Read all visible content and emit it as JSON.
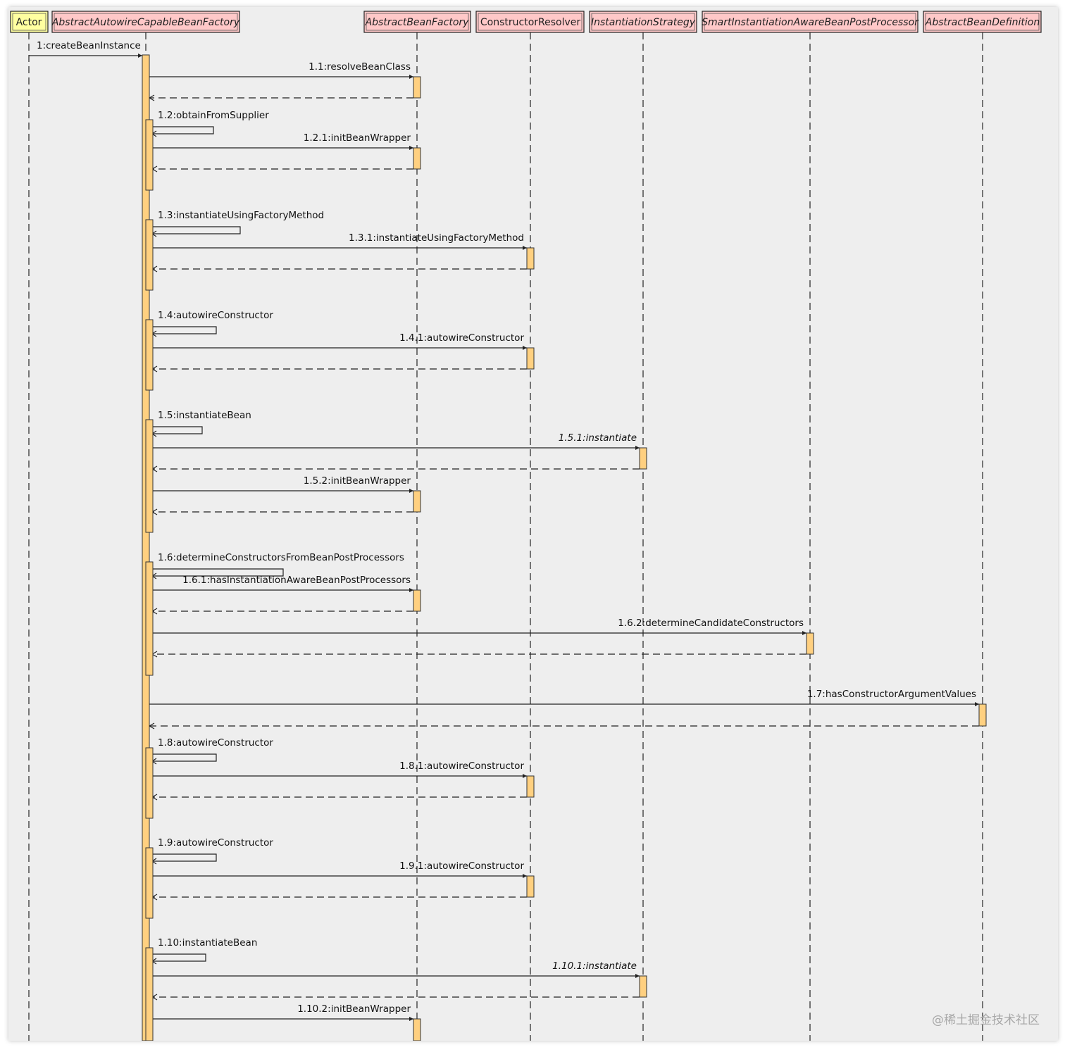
{
  "participants": [
    {
      "id": "actor",
      "label": "Actor",
      "italic": false,
      "fill": "#ffffa0"
    },
    {
      "id": "aacbf",
      "label": "AbstractAutowireCapableBeanFactory",
      "italic": true,
      "fill": "#ffc8c8"
    },
    {
      "id": "abf",
      "label": "AbstractBeanFactory",
      "italic": true,
      "fill": "#ffc8c8"
    },
    {
      "id": "cr",
      "label": "ConstructorResolver",
      "italic": false,
      "fill": "#ffc8c8"
    },
    {
      "id": "is",
      "label": "InstantiationStrategy",
      "italic": true,
      "fill": "#ffc8c8"
    },
    {
      "id": "siabpp",
      "label": "SmartInstantiationAwareBeanPostProcessor",
      "italic": true,
      "fill": "#ffc8c8"
    },
    {
      "id": "abd",
      "label": "AbstractBeanDefinition",
      "italic": true,
      "fill": "#ffc8c8"
    }
  ],
  "messages": [
    {
      "label": "1:createBeanInstance",
      "from": "actor",
      "to": "aacbf",
      "type": "call"
    },
    {
      "label": "1.1:resolveBeanClass",
      "from": "aacbf",
      "to": "abf",
      "type": "call"
    },
    {
      "label": "",
      "from": "abf",
      "to": "aacbf",
      "type": "return"
    },
    {
      "label": "1.2:obtainFromSupplier",
      "from": "aacbf",
      "to": "aacbf",
      "type": "self"
    },
    {
      "label": "1.2.1:initBeanWrapper",
      "from": "aacbf",
      "to": "abf",
      "type": "call"
    },
    {
      "label": "",
      "from": "abf",
      "to": "aacbf",
      "type": "return"
    },
    {
      "label": "1.3:instantiateUsingFactoryMethod",
      "from": "aacbf",
      "to": "aacbf",
      "type": "self"
    },
    {
      "label": "1.3.1:instantiateUsingFactoryMethod",
      "from": "aacbf",
      "to": "cr",
      "type": "call"
    },
    {
      "label": "",
      "from": "cr",
      "to": "aacbf",
      "type": "return"
    },
    {
      "label": "1.4:autowireConstructor",
      "from": "aacbf",
      "to": "aacbf",
      "type": "self"
    },
    {
      "label": "1.4.1:autowireConstructor",
      "from": "aacbf",
      "to": "cr",
      "type": "call"
    },
    {
      "label": "",
      "from": "cr",
      "to": "aacbf",
      "type": "return"
    },
    {
      "label": "1.5:instantiateBean",
      "from": "aacbf",
      "to": "aacbf",
      "type": "self"
    },
    {
      "label": "1.5.1:instantiate",
      "from": "aacbf",
      "to": "is",
      "type": "call",
      "italic": true
    },
    {
      "label": "",
      "from": "is",
      "to": "aacbf",
      "type": "return"
    },
    {
      "label": "1.5.2:initBeanWrapper",
      "from": "aacbf",
      "to": "abf",
      "type": "call"
    },
    {
      "label": "",
      "from": "abf",
      "to": "aacbf",
      "type": "return"
    },
    {
      "label": "1.6:determineConstructorsFromBeanPostProcessors",
      "from": "aacbf",
      "to": "aacbf",
      "type": "self"
    },
    {
      "label": "1.6.1:hasInstantiationAwareBeanPostProcessors",
      "from": "aacbf",
      "to": "abf",
      "type": "call"
    },
    {
      "label": "",
      "from": "abf",
      "to": "aacbf",
      "type": "return"
    },
    {
      "label": "1.6.2:determineCandidateConstructors",
      "from": "aacbf",
      "to": "siabpp",
      "type": "call"
    },
    {
      "label": "",
      "from": "siabpp",
      "to": "aacbf",
      "type": "return"
    },
    {
      "label": "1.7:hasConstructorArgumentValues",
      "from": "aacbf",
      "to": "abd",
      "type": "call"
    },
    {
      "label": "",
      "from": "abd",
      "to": "aacbf",
      "type": "return"
    },
    {
      "label": "1.8:autowireConstructor",
      "from": "aacbf",
      "to": "aacbf",
      "type": "self"
    },
    {
      "label": "1.8.1:autowireConstructor",
      "from": "aacbf",
      "to": "cr",
      "type": "call"
    },
    {
      "label": "",
      "from": "cr",
      "to": "aacbf",
      "type": "return"
    },
    {
      "label": "1.9:autowireConstructor",
      "from": "aacbf",
      "to": "aacbf",
      "type": "self"
    },
    {
      "label": "1.9.1:autowireConstructor",
      "from": "aacbf",
      "to": "cr",
      "type": "call"
    },
    {
      "label": "",
      "from": "cr",
      "to": "aacbf",
      "type": "return"
    },
    {
      "label": "1.10:instantiateBean",
      "from": "aacbf",
      "to": "aacbf",
      "type": "self"
    },
    {
      "label": "1.10.1:instantiate",
      "from": "aacbf",
      "to": "is",
      "type": "call",
      "italic": true
    },
    {
      "label": "",
      "from": "is",
      "to": "aacbf",
      "type": "return"
    },
    {
      "label": "1.10.2:initBeanWrapper",
      "from": "aacbf",
      "to": "abf",
      "type": "call"
    }
  ],
  "colors": {
    "activation_fill": "#ffd080",
    "activation_stroke": "#333333",
    "line": "#222222",
    "lifeline": "#333333"
  },
  "watermark": "@稀土掘金技术社区"
}
